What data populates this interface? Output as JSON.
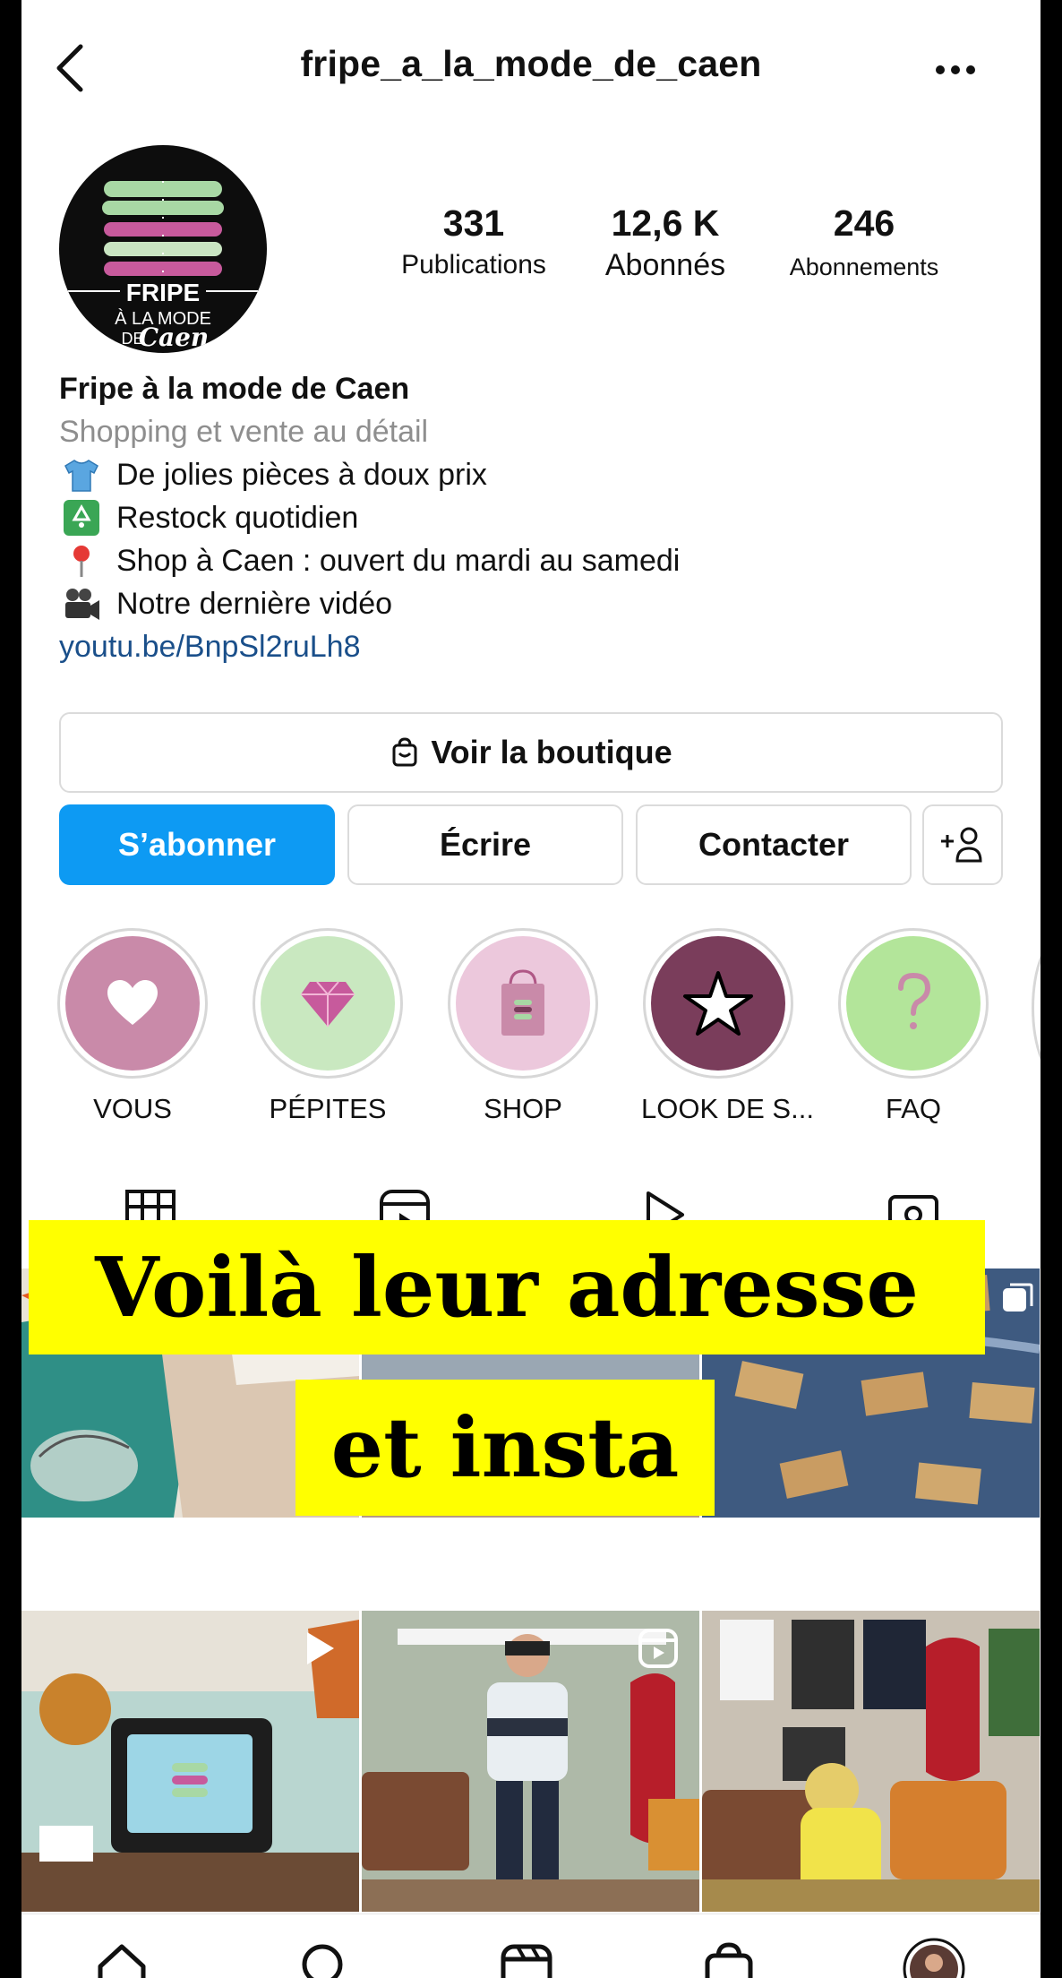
{
  "header": {
    "username": "fripe_a_la_mode_de_caen"
  },
  "profile": {
    "avatar_logo": {
      "line1": "FRIPE",
      "line2": "À LA MODE",
      "line3": "DE",
      "line4": "Caen"
    },
    "stats": [
      {
        "value": "331",
        "label": "Publications"
      },
      {
        "value": "12,6 K",
        "label": "Abonnés"
      },
      {
        "value": "246",
        "label": "Abonnements"
      }
    ],
    "name": "Fripe à la mode de Caen",
    "category": "Shopping et vente au détail",
    "bio_lines": [
      {
        "icon": "shirt-icon",
        "text": "De jolies pièces à doux prix"
      },
      {
        "icon": "recycle-icon",
        "text": "Restock quotidien"
      },
      {
        "icon": "pin-icon",
        "text": "Shop à Caen : ouvert du mardi au samedi"
      },
      {
        "icon": "video-camera-icon",
        "text": "Notre dernière vidéo"
      }
    ],
    "link": "youtu.be/BnpSl2ruLh8"
  },
  "actions": {
    "shop": "Voir la boutique",
    "follow": "S’abonner",
    "message": "Écrire",
    "contact": "Contacter"
  },
  "highlights": [
    {
      "label": "VOUS",
      "icon": "heart-icon",
      "color": "#c98aa9"
    },
    {
      "label": "PÉPITES",
      "icon": "diamond-icon",
      "color": "#c9e8c0"
    },
    {
      "label": "SHOP",
      "icon": "shopping-bag-icon",
      "color": "#ecc8dc"
    },
    {
      "label": "LOOK DE S...",
      "icon": "star-icon",
      "color": "#7a3d5b"
    },
    {
      "label": "FAQ",
      "icon": "question-icon",
      "color": "#b3e59a"
    }
  ],
  "overlay": {
    "line1": "Voilà leur adresse",
    "line2": "et insta"
  },
  "colors": {
    "accent": "#0d9af3",
    "link": "#1a4f8a",
    "highlight_yellow": "#ffff00"
  }
}
